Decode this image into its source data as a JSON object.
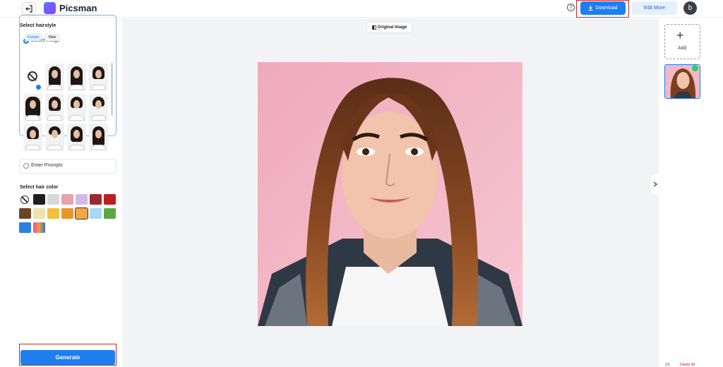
{
  "header": {
    "brand": "Picsman",
    "help_icon": "?",
    "download_label": "Download",
    "edit_more_label": "Edit More",
    "avatar_initial": "b"
  },
  "left_panel": {
    "hairstyle_title": "Select hairstyle",
    "select_image_label": "Select Image",
    "tabs": [
      "Female",
      "Male"
    ],
    "enter_prompts_label": "Enter Prompts",
    "hair_color_title": "Select hair color",
    "hair_colors": [
      "none",
      "#1f1f1f",
      "#d8d8d8",
      "#e7a2b0",
      "#d6b8e6",
      "#9b2b32",
      "#bf1e1e",
      "#6b4426",
      "#efe1b0",
      "#f3c03c",
      "#e8962b",
      "#f4a640",
      "#a8d8ef",
      "#5aa840",
      "#2f7fe0",
      "#e04fb0"
    ],
    "generate_label": "Generate"
  },
  "canvas": {
    "original_image_label": "Original Image"
  },
  "right_panel": {
    "add_label": "Add",
    "page_count": "1/1",
    "delete_all_label": "Delete All"
  }
}
